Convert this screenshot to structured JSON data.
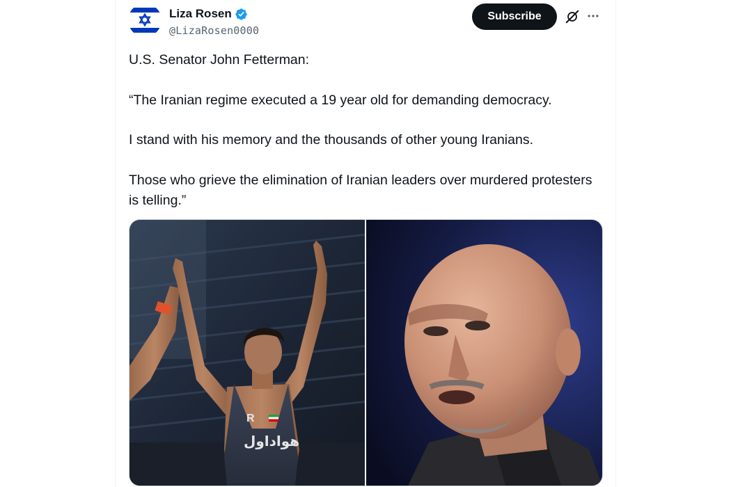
{
  "author": {
    "display_name": "Liza Rosen",
    "handle": "@LizaRosen0000",
    "verified": true,
    "avatar_icon": "israel-flag-avatar-icon"
  },
  "actions": {
    "subscribe_label": "Subscribe",
    "grok_icon": "grok-icon",
    "more_icon": "more-options-icon"
  },
  "tweet": {
    "paragraphs": [
      "U.S. Senator John Fetterman:",
      "“The Iranian regime executed a 19 year old for demanding democracy.",
      "I stand with his memory and the thousands of other young Iranians.",
      "Those who grieve the elimination of Iranian leaders over murdered protesters is telling.”"
    ]
  },
  "media": {
    "images": [
      {
        "name": "wrestler-photo",
        "jersey_text": "هواداول",
        "jersey_logo": "R"
      },
      {
        "name": "senator-photo"
      }
    ]
  },
  "colors": {
    "text_primary": "#0f1419",
    "text_secondary": "#536471",
    "verified_blue": "#1d9bf0",
    "flag_blue": "#0038b8",
    "border": "#cfd9de"
  }
}
